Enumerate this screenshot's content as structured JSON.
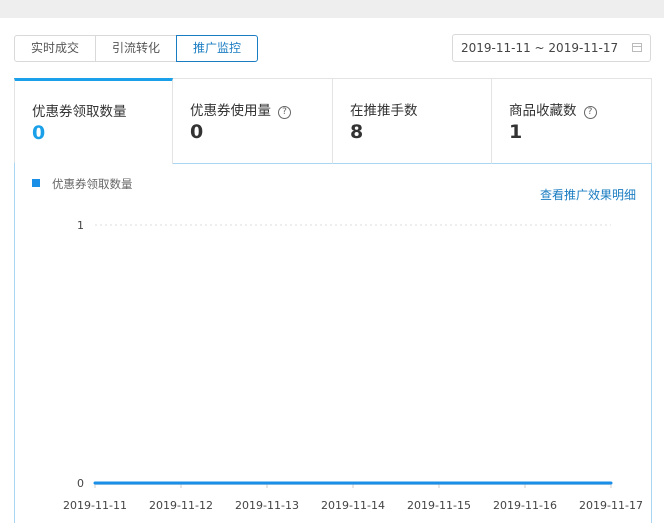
{
  "tabs": [
    {
      "label": "实时成交",
      "active": false
    },
    {
      "label": "引流转化",
      "active": false
    },
    {
      "label": "推广监控",
      "active": true
    }
  ],
  "date_range": {
    "value": "2019-11-11 ~ 2019-11-17",
    "icon": "calendar-icon"
  },
  "metrics": [
    {
      "label": "优惠券领取数量",
      "value": "0",
      "help": false,
      "selected": true
    },
    {
      "label": "优惠券使用量",
      "value": "0",
      "help": true,
      "selected": false
    },
    {
      "label": "在推推手数",
      "value": "8",
      "help": false,
      "selected": false
    },
    {
      "label": "商品收藏数",
      "value": "1",
      "help": true,
      "selected": false
    }
  ],
  "help_icon_glyph": "?",
  "detail_link": "查看推广效果明细",
  "colors": {
    "accent": "#1aa0e8",
    "series": "#1a8fe8",
    "link": "#1a7cc2"
  },
  "chart_data": {
    "type": "line",
    "x": [
      "2019-11-11",
      "2019-11-12",
      "2019-11-13",
      "2019-11-14",
      "2019-11-15",
      "2019-11-16",
      "2019-11-17"
    ],
    "series": [
      {
        "name": "优惠券领取数量",
        "values": [
          0,
          0,
          0,
          0,
          0,
          0,
          0
        ]
      }
    ],
    "y_ticks": [
      "0",
      "1"
    ],
    "ylim": [
      0,
      1
    ],
    "grid": true,
    "legend": "top-left"
  }
}
